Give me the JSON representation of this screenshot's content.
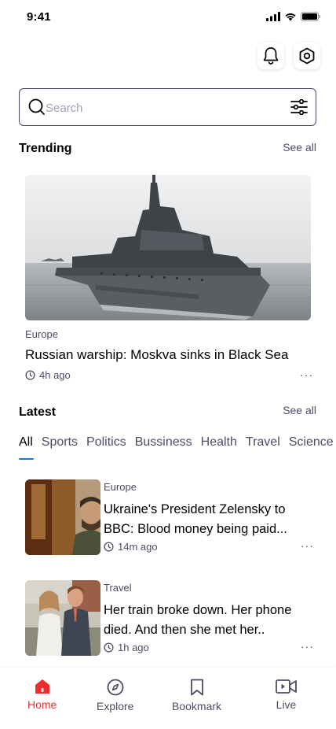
{
  "status_bar": {
    "time": "9:41"
  },
  "search": {
    "placeholder": "Search"
  },
  "trending": {
    "title": "Trending",
    "see_all": "See all",
    "article": {
      "category": "Europe",
      "title": "Russian warship: Moskva sinks in Black Sea",
      "time": "4h ago",
      "more": "···"
    }
  },
  "latest": {
    "title": "Latest",
    "see_all": "See all",
    "tabs": [
      "All",
      "Sports",
      "Politics",
      "Bussiness",
      "Health",
      "Travel",
      "Science"
    ],
    "active_tab": "All",
    "articles": [
      {
        "category": "Europe",
        "title": "Ukraine's President Zelensky to BBC: Blood money being paid...",
        "time": "14m ago",
        "more": "···"
      },
      {
        "category": "Travel",
        "title": "Her train broke down. Her phone died. And then she met her..",
        "time": "1h ago",
        "more": "···"
      }
    ]
  },
  "bottom_nav": {
    "items": [
      {
        "label": "Home",
        "icon": "home-icon",
        "active": true
      },
      {
        "label": "Explore",
        "icon": "compass-icon",
        "active": false
      },
      {
        "label": "Bookmark",
        "icon": "bookmark-icon",
        "active": false
      },
      {
        "label": "Live",
        "icon": "video-icon",
        "active": false
      }
    ]
  },
  "colors": {
    "accent_red": "#ED2E2E",
    "tab_underline": "#1877F2",
    "secondary_text": "#4E4B66",
    "placeholder": "#A0A3BD"
  }
}
